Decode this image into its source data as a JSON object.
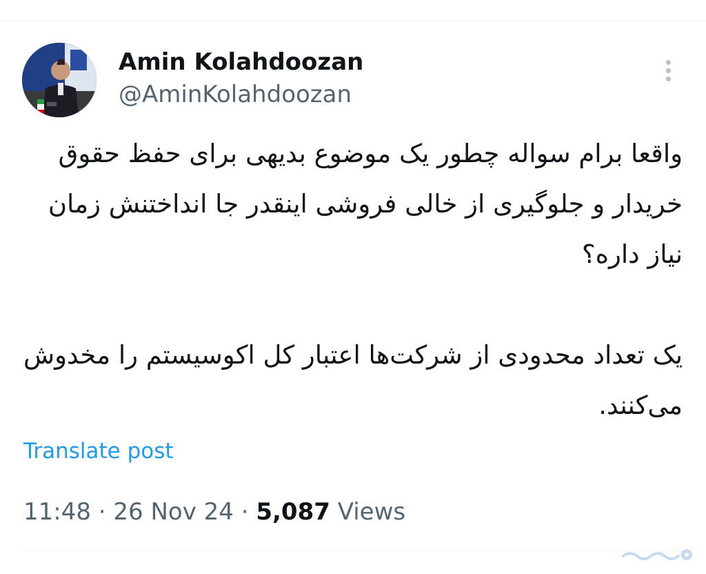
{
  "colors": {
    "link": "#1d9bf0",
    "text_primary": "#0f1419",
    "text_secondary": "#536471",
    "divider": "#eff3f4"
  },
  "author": {
    "display_name": "Amin Kolahdoozan",
    "handle": "@AminKolahdoozan",
    "avatar_icon": "profile-photo"
  },
  "more_menu_icon": "vertical-ellipsis-icon",
  "tweet": {
    "paragraphs": [
      "واقعا برام سواله چطور یک موضوع بدیهی برای حفظ حقوق خریدار و جلوگیری از خالی فروشی اینقدر جا انداختنش زمان نیاز داره؟",
      "یک تعداد محدودی از شرکت‌ها اعتبار کل اکوسیستم را مخدوش می‌کنند."
    ]
  },
  "translate_label": "Translate post",
  "meta": {
    "time": "11:48",
    "separator": " · ",
    "date": "26 Nov 24",
    "views_count": "5,087",
    "views_label": " Views"
  },
  "watermark": {
    "logo_icon": "site-watermark-logo"
  }
}
